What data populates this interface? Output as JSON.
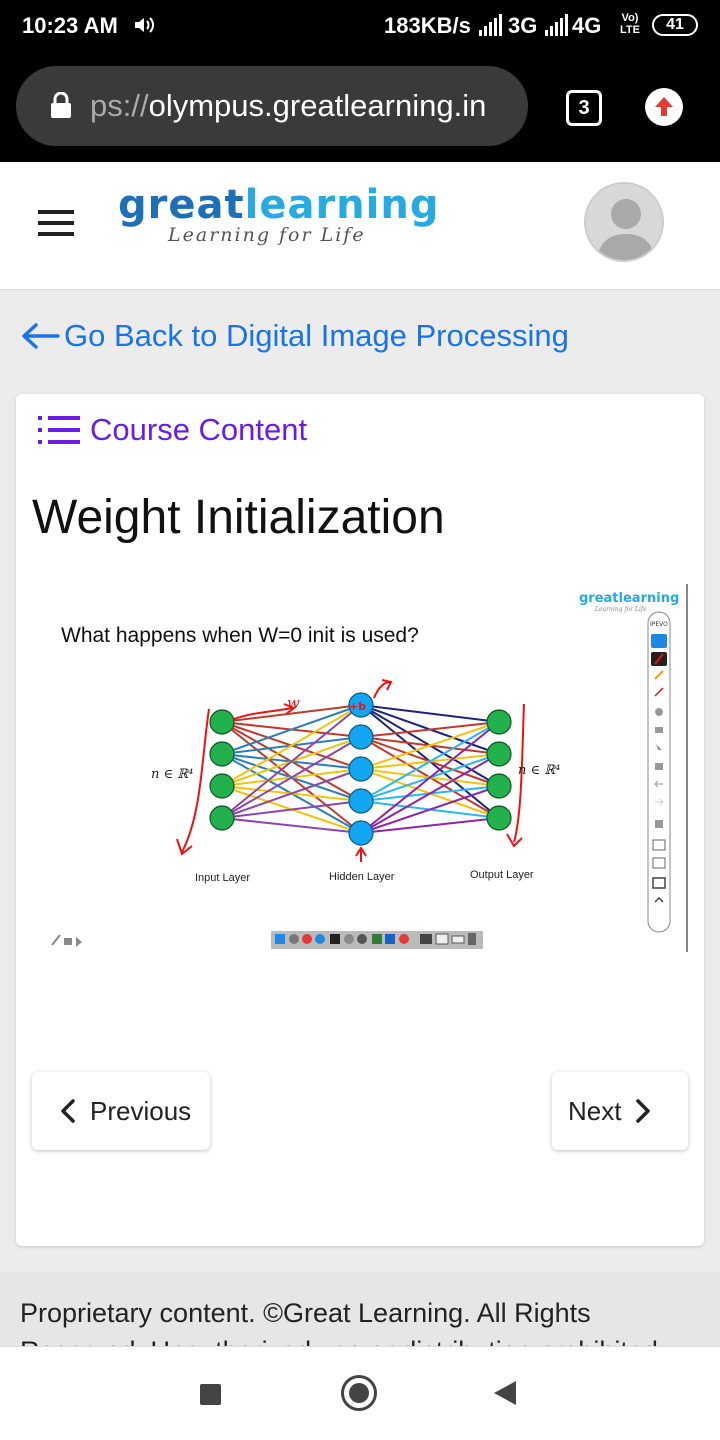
{
  "status_bar": {
    "time": "10:23 AM",
    "net_rate": "183KB/s",
    "net1": "3G",
    "net2": "4G",
    "volte": "Vo) LTE",
    "battery": "41"
  },
  "browser": {
    "url_prefix": "ps://",
    "url_host": "olympus.greatlearning.in",
    "tab_count": "3"
  },
  "header": {
    "logo_part1": "great",
    "logo_part2": "learning",
    "logo_tagline": "Learning for Life"
  },
  "back_link": "Go Back to Digital Image Processing",
  "course_content_label": "Course Content",
  "lesson_title": "Weight Initialization",
  "slide": {
    "question": "What happens when W=0 init is used?",
    "input_label": "Input Layer",
    "hidden_label": "Hidden Layer",
    "output_label": "Output Layer",
    "left_annotation": "n ∈ ℝ⁴",
    "right_annotation": "n ∈ ℝ⁴",
    "brand": "greatlearning",
    "brand_tag": "Learning for Life",
    "toolbar_brand": "IPEVO",
    "handwritten_w": "w",
    "handwritten_b": "+b"
  },
  "buttons": {
    "previous": "Previous",
    "next": "Next"
  },
  "footer": "Proprietary content. ©Great Learning. All Rights Reserved. Unauthorized use or distribution prohibited."
}
